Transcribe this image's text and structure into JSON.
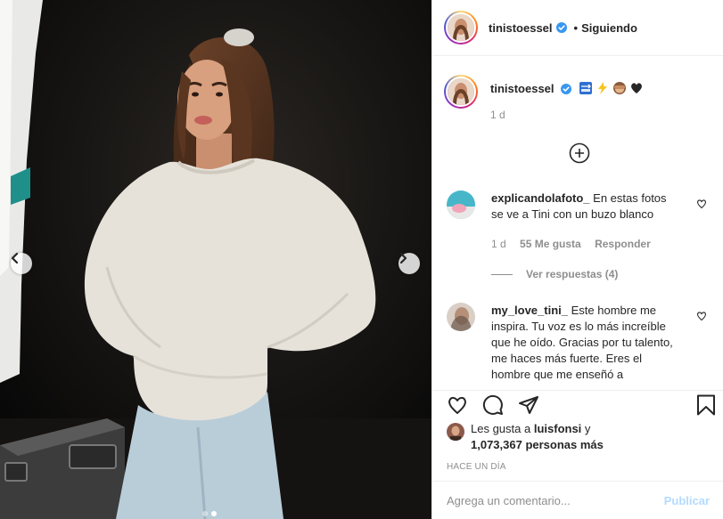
{
  "post": {
    "carousel": {
      "slide_count": 2,
      "active_index": 1
    }
  },
  "header": {
    "username": "tinistoessel",
    "separator": "•",
    "follow_status": "Siguiendo"
  },
  "caption": {
    "username": "tinistoessel",
    "emojis": [
      "soon-arrow-icon",
      "high-voltage-icon",
      "see-no-evil-monkey-icon",
      "black-heart-icon"
    ],
    "time": "1 d"
  },
  "comments": [
    {
      "username": "explicandolafoto_",
      "text": "En estas fotos se ve a Tini con un buzo blanco",
      "time": "1 d",
      "likes": "55 Me gusta",
      "reply_label": "Responder",
      "view_replies": "Ver respuestas (4)"
    },
    {
      "username": "my_love_tini_",
      "text": "Este hombre me inspira. Tu voz es lo más increíble que he oído. Gracias por tu talento, me haces más fuerte. Eres el hombre que me enseñó a"
    }
  ],
  "likes": {
    "prefix": "Les gusta a",
    "user": "luisfonsi",
    "conjunction": "y",
    "count_text": "1,073,367 personas más"
  },
  "timestamp": "Hace un día",
  "add_comment": {
    "placeholder": "Agrega un comentario...",
    "post_label": "Publicar"
  },
  "colors": {
    "verified": "#3897f0",
    "post_button_disabled": "#b3dbff",
    "muted_text": "#8e8e8e",
    "border": "#efefef"
  }
}
